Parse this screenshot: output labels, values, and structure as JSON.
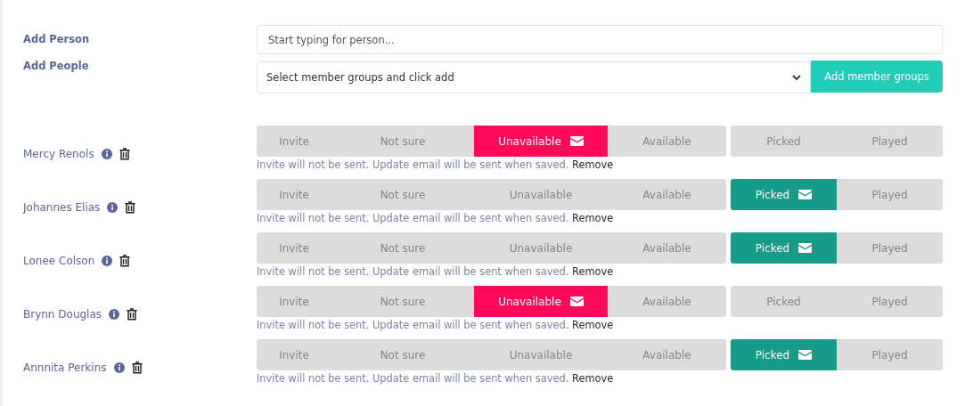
{
  "add_person": {
    "label": "Add Person",
    "placeholder": "Start typing for person..."
  },
  "add_people": {
    "label": "Add People",
    "value": "Select member groups and click add",
    "button": "Add member groups"
  },
  "people": [
    {
      "name": "Mercy Renols",
      "groups": [
        {
          "kind": "availability",
          "options": [
            {
              "label": "Invite",
              "selected": false
            },
            {
              "label": "Not sure",
              "selected": false
            },
            {
              "label": "Unavailable",
              "selected": true
            },
            {
              "label": "Available",
              "selected": false
            }
          ]
        },
        {
          "kind": "selection",
          "options": [
            {
              "label": "Picked",
              "selected": false
            },
            {
              "label": "Played",
              "selected": false
            }
          ]
        }
      ],
      "note": "Invite will not be sent. Update email will be sent when saved.",
      "link": "Remove"
    },
    {
      "name": "Johannes Elias",
      "groups": [
        {
          "kind": "availability",
          "options": [
            {
              "label": "Invite",
              "selected": false
            },
            {
              "label": "Not sure",
              "selected": false
            },
            {
              "label": "Unavailable",
              "selected": false
            },
            {
              "label": "Available",
              "selected": false
            }
          ]
        },
        {
          "kind": "selection",
          "options": [
            {
              "label": "Picked",
              "selected": true
            },
            {
              "label": "Played",
              "selected": false
            }
          ]
        }
      ],
      "note": "Invite will not be sent. Update email will be sent when saved.",
      "link": "Remove"
    },
    {
      "name": "Lonee Colson",
      "groups": [
        {
          "kind": "availability",
          "options": [
            {
              "label": "Invite",
              "selected": false
            },
            {
              "label": "Not sure",
              "selected": false
            },
            {
              "label": "Unavailable",
              "selected": false
            },
            {
              "label": "Available",
              "selected": false
            }
          ]
        },
        {
          "kind": "selection",
          "options": [
            {
              "label": "Picked",
              "selected": true
            },
            {
              "label": "Played",
              "selected": false
            }
          ]
        }
      ],
      "note": "Invite will not be sent. Update email will be sent when saved.",
      "link": "Remove"
    },
    {
      "name": "Brynn Douglas",
      "groups": [
        {
          "kind": "availability",
          "options": [
            {
              "label": "Invite",
              "selected": false
            },
            {
              "label": "Not sure",
              "selected": false
            },
            {
              "label": "Unavailable",
              "selected": true
            },
            {
              "label": "Available",
              "selected": false
            }
          ]
        },
        {
          "kind": "selection",
          "options": [
            {
              "label": "Picked",
              "selected": false
            },
            {
              "label": "Played",
              "selected": false
            }
          ]
        }
      ],
      "note": "Invite will not be sent. Update email will be sent when saved.",
      "link": "Remove"
    },
    {
      "name": "Annnita Perkins",
      "groups": [
        {
          "kind": "availability",
          "options": [
            {
              "label": "Invite",
              "selected": false
            },
            {
              "label": "Not sure",
              "selected": false
            },
            {
              "label": "Unavailable",
              "selected": false
            },
            {
              "label": "Available",
              "selected": false
            }
          ]
        },
        {
          "kind": "selection",
          "options": [
            {
              "label": "Picked",
              "selected": true
            },
            {
              "label": "Played",
              "selected": false
            }
          ]
        }
      ],
      "note": "Invite will not be sent. Update email will be sent when saved.",
      "link": "Remove"
    }
  ]
}
